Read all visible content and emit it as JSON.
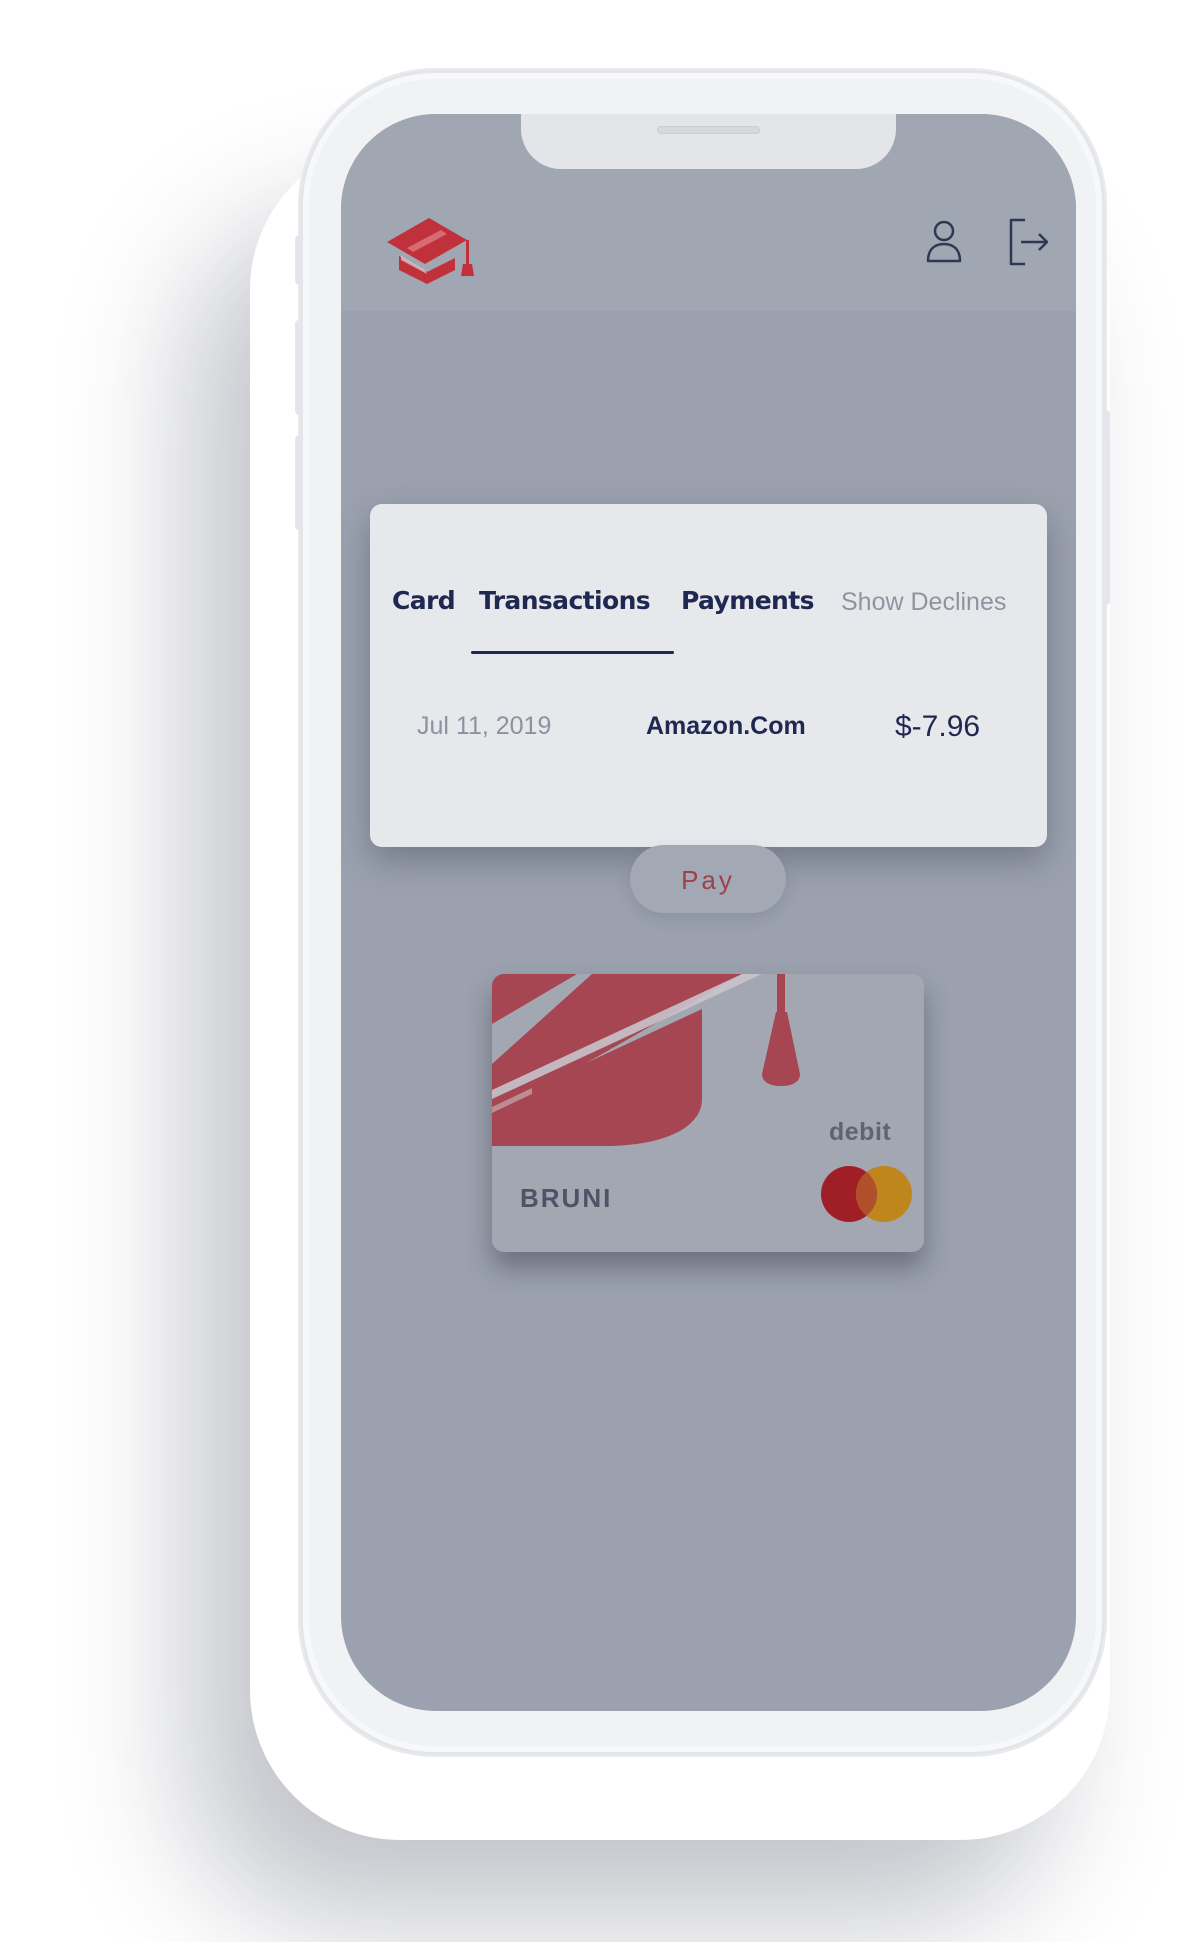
{
  "header": {
    "logo_icon": "graduation-cap-card-logo",
    "profile_icon": "user-icon",
    "logout_icon": "logout-icon"
  },
  "tabs": [
    {
      "label": "Card",
      "active": false
    },
    {
      "label": "Transactions",
      "active": true
    },
    {
      "label": "Payments",
      "active": false
    },
    {
      "label": "Show Declines",
      "active": false
    }
  ],
  "transactions": [
    {
      "date": "Jul 11, 2019",
      "merchant": "Amazon.Com",
      "amount": "$-7.96"
    }
  ],
  "pay_button": {
    "label": "Pay"
  },
  "debit_card": {
    "type_label": "debit",
    "holder_name": "BRUNI",
    "network_icon": "mastercard-logo"
  },
  "colors": {
    "brand_red": "#c0313c",
    "navy": "#1e2850",
    "screen_overlay": "#9ba1ae",
    "panel": "#e7e8eb"
  }
}
